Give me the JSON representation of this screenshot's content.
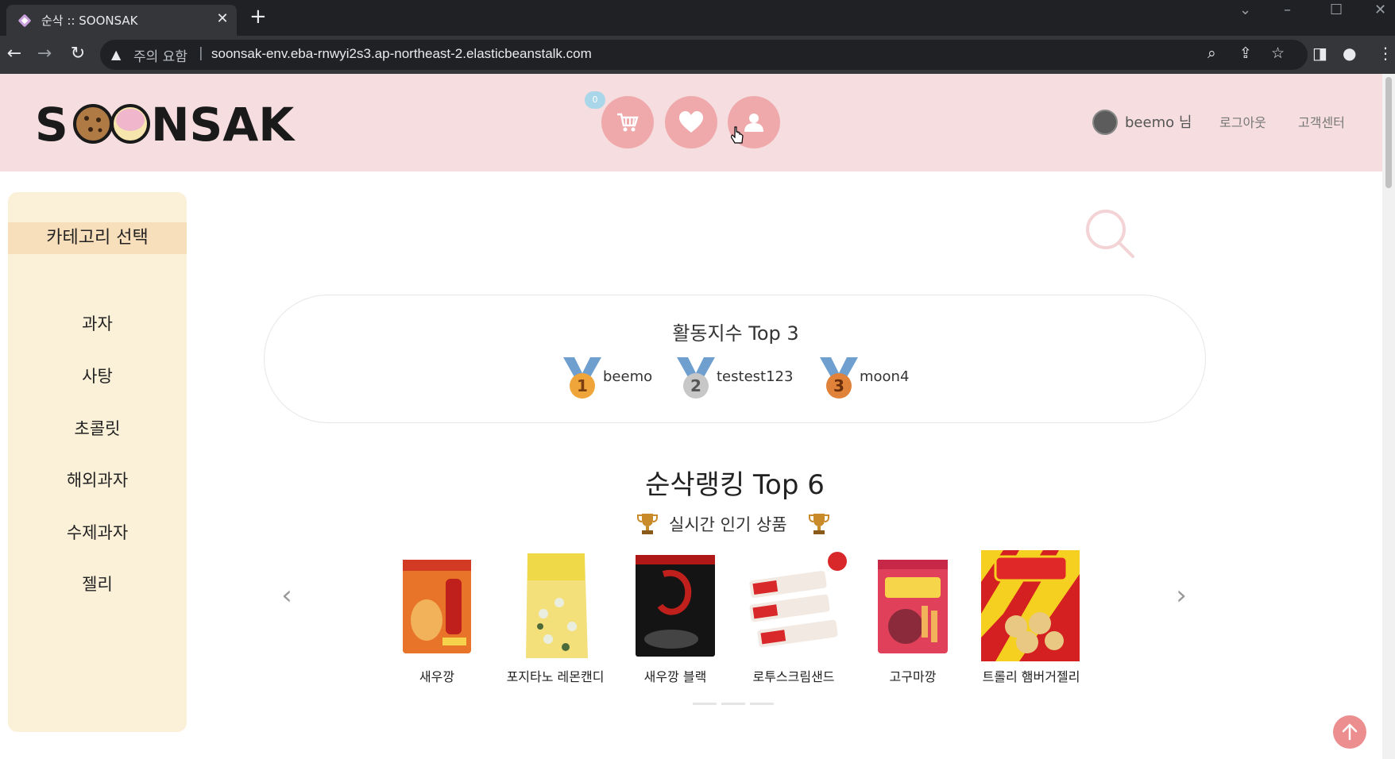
{
  "browser": {
    "tab_title": "순삭 :: SOONSAK",
    "tab_close": "✕",
    "new_tab": "+",
    "security_warning": "주의 요함",
    "url_separator": "|",
    "url": "soonsak-env.eba-rnwyi2s3.ap-northeast-2.elasticbeanstalk.com"
  },
  "header": {
    "logo": "SOONSAK",
    "cart_count": "0",
    "username": "beemo 님",
    "logout_label": "로그아웃",
    "support_label": "고객센터",
    "colors": {
      "background": "#f5dde0",
      "icon_circle": "#f0a9ab"
    }
  },
  "sidebar": {
    "title": "카테고리 선택",
    "items": [
      {
        "label": "과자"
      },
      {
        "label": "사탕"
      },
      {
        "label": "초콜릿"
      },
      {
        "label": "해외과자"
      },
      {
        "label": "수제과자"
      },
      {
        "label": "젤리"
      }
    ]
  },
  "activity": {
    "title": "활동지수 Top 3",
    "ranks": [
      {
        "rank": "1",
        "name": "beemo",
        "medal_color": "#f0a53a"
      },
      {
        "rank": "2",
        "name": "testest123",
        "medal_color": "#c7c7c7"
      },
      {
        "rank": "3",
        "name": "moon4",
        "medal_color": "#e0823a"
      }
    ]
  },
  "ranking": {
    "title": "순삭랭킹 Top 6",
    "subtitle": "실시간 인기 상품",
    "prev_label": "‹",
    "next_label": "›",
    "products": [
      {
        "name": "새우깡"
      },
      {
        "name": "포지타노 레몬캔디"
      },
      {
        "name": "새우깡 블랙"
      },
      {
        "name": "로투스크림샌드"
      },
      {
        "name": "고구마깡"
      },
      {
        "name": "트롤리 햄버거젤리"
      }
    ]
  },
  "scroll_top_icon": "arrow-up-icon"
}
